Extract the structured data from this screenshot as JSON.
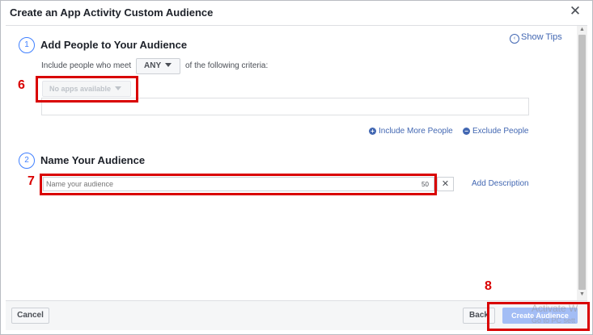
{
  "dialog": {
    "title": "Create an App Activity Custom Audience",
    "close_glyph": "✕",
    "show_tips": "Show Tips"
  },
  "section1": {
    "number": "1",
    "title": "Add People to Your Audience",
    "criteria_prefix": "Include people who meet",
    "criteria_match": "ANY",
    "criteria_suffix": "of the following criteria:",
    "apps_dropdown": "No apps available",
    "include_more": "Include More People",
    "exclude": "Exclude People"
  },
  "section2": {
    "number": "2",
    "title": "Name Your Audience",
    "name_placeholder": "Name your audience",
    "char_remaining": "50",
    "clear_glyph": "✕",
    "add_description": "Add Description"
  },
  "footer": {
    "cancel": "Cancel",
    "back": "Back",
    "create": "Create Audience"
  },
  "watermark": {
    "line1": "Activate W",
    "line2": "Go to PC sett"
  },
  "annotations": [
    {
      "label": "6"
    },
    {
      "label": "7"
    },
    {
      "label": "8"
    }
  ],
  "colors": {
    "accent": "#4267b2",
    "step_circle": "#4080ff",
    "annotation_red": "#d90000",
    "create_button": "#a3bdf5"
  }
}
